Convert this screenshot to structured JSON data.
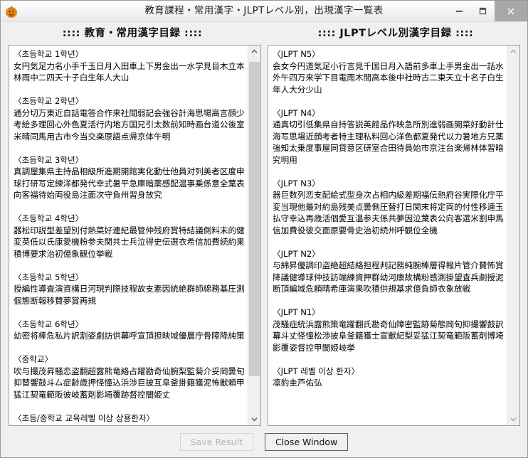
{
  "window": {
    "title": "教育課程・常用漢字・JLPTレベル別，出現漢字一覧表",
    "icon": "pumpkin-app-icon",
    "minimize_label": "─",
    "maximize_label": "□",
    "close_label": "✕"
  },
  "headers": {
    "left": ":::: 教育・常用漢字目録 ::::",
    "right": ":::: JLPTレベル別漢字目録 ::::"
  },
  "left_panel": {
    "groups": [
      {
        "heading": "〈초등학교 1학년〉",
        "kanji": "女円気足力名小手千玉日月入田車上下男金出一水学見目木立本林雨中二四天十子白生年人大山"
      },
      {
        "heading": "〈초등학교 2학년〉",
        "kanji": "通分切万東近自話電答合作来社間弱記会強谷計海思場高言顔少考絵多理回心外色夏活行内地方国兄引太数前知時画台道公後室米晴同馬用古市今当交楽原語点帰京体午明"
      },
      {
        "heading": "〈초등학교 3학년〉",
        "kanji": "真調屋集県主持品相級所進期開館実化動仕他員対列美者区度申球打研写定練洋都発代幸式暑平急庫暗薬感配温事乗係意全葉表向客福待始両役島注面次守負州習身放究"
      },
      {
        "heading": "〈초등학교 4학년〉",
        "kanji": "器松印説型差望別付熱菜好連紀最管仲残府賞特結議側料末的健変英低以氏康愛機粉参夫関共士兵泣得史伝選衣希信加費続約果積博要求治初億象観位挙戦"
      },
      {
        "heading": "〈초등학교 5학년〉",
        "kanji": "授編性導査演資構日河現判際技程故支素因統絶群師綿務基圧測個態断報移賛夢賞再規"
      },
      {
        "heading": "〈초등학교 6학년〉",
        "kanji": "幼密将棒危私片訳割姿劇訪供幕呼宣頂担映域優層庁骨障降純策"
      },
      {
        "heading": "〈중학교〉",
        "kanji": "吹与撮茂昇騒恋盗翻超露熊竜絡占躍勘奇仙腕梨監菊介妥岡曇旬抑替響鼓斗厶症齢歳押怪憧込浜渉巨披互阜釜掛籍獲泥怖獣頼甲猛江契竜範阪彼岐蓄剤影埼覆跡督控闇姫丈"
      },
      {
        "heading": "〈초등/중학교 교육레벨 이상 상용한자〉",
        "kanji": ""
      }
    ]
  },
  "right_panel": {
    "groups": [
      {
        "heading": "〈JLPT N5〉",
        "kanji": "会女今円道気足小行言見千国日月入語前多車上手男金出一話水外午四万来学下目電雨木間高本後中社時古二東天立十名子白生年人大分少山"
      },
      {
        "heading": "〈JLPT N4〉",
        "kanji": "通真切引低集県自持答説英館品作映急所別進弱画開菜好動計仕海写思場近顔考者特主理私料回心洋色都夏発代以力暑地方兄薬強知太乗度事屋同貸意区研室合田待員始市京注台楽帰林体習暗究明用"
      },
      {
        "heading": "〈JLPT N3〉",
        "kanji": "器巨数列恋支配絵式型身次占相内級差期福伝熱府谷実際化庁平変当現他最対約島残美点曇側圧替打日関末将定両的付性移連玉払守幸込再歳活個愛互温参夫係共夢因泣葉表公向客選米割申馬信加費役彼交面原要骨史治初続州呼観位全機"
      },
      {
        "heading": "〈JLPT N2〉",
        "kanji": "与綿昇優調印盗絶超結絡担程判記務純腕棒層得報片管介賛怖賞降議健導球仲技訪端練資押群幼河康故構粉感測掛望査兵劇授泥断頂編域危頼晴希庫演果吹積供規基求億負師衣象放戦"
      },
      {
        "heading": "〈JLPT N1〉",
        "kanji": "茂騒症統浜露熊策竜躍翻氏勘奇仙障密監跡菊態岡旬抑撮響鼓訳幕斗丈怪憧松渉披阜釜籍獲士宣獣紀梨妥猛江契竜範阪蓄剤博埼影覆姿督控甲闇姫岐挙"
      },
      {
        "heading": "〈JLPT 레벨 이상 한자〉",
        "kanji": "凛豹圭芦佑弘"
      }
    ]
  },
  "footer": {
    "save_label": "Save Result",
    "close_label": "Close Window"
  },
  "colors": {
    "window_bg": "#f0f0f0",
    "panel_bg": "#ffffff",
    "close_btn": "#a8a8a8",
    "scroll_thumb": "#cdcdcd",
    "text": "#000000",
    "disabled_text": "#b4b4b4"
  }
}
